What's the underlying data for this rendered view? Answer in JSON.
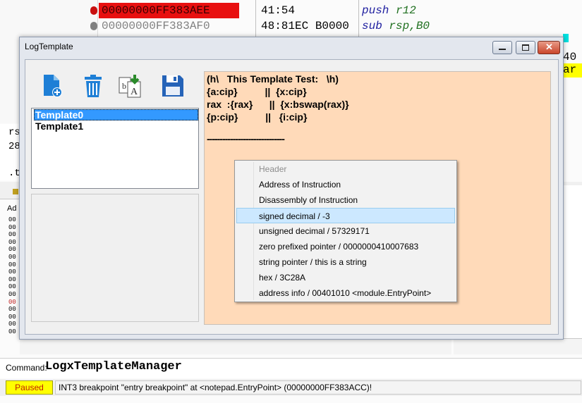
{
  "background": {
    "disasm_rows": [
      {
        "address": "00000000FF383AEE",
        "bytes": "41:54",
        "mnemonic": "push",
        "operand": "r12"
      },
      {
        "address": "00000000FF383AF0",
        "bytes": "48:81EC B0000",
        "mnemonic": "sub",
        "operand": "rsp,B0"
      }
    ],
    "register_fragments": [
      "rs",
      "28",
      ".t"
    ],
    "right_fragments": [
      "40",
      "ar"
    ],
    "hex_prefix": "Ad",
    "hex_rows": [
      "00",
      "00",
      "00",
      "00",
      "00",
      "00",
      "00",
      "00",
      "00",
      "00",
      "00",
      "00",
      "00",
      "00",
      "00",
      "00"
    ]
  },
  "dialog": {
    "title": "LogTemplate",
    "toolbar": [
      {
        "name": "new-template-icon",
        "color": "#1e7fd6"
      },
      {
        "name": "delete-template-icon",
        "color": "#1e7fd6"
      },
      {
        "name": "import-template-icon",
        "color": "#2a8a2a"
      },
      {
        "name": "save-template-icon",
        "color": "#2563b8"
      }
    ],
    "templates": [
      "Template0",
      "Template1"
    ],
    "selected_template": 0,
    "editor_lines": [
      "(h\\   This Template Test:   \\h)",
      "{a:cip}          ||  {x:cip}",
      "rax  :{rax}      ||  {x:bswap(rax)}",
      "{p:cip}          ||   {i:cip}",
      "",
      "------------------------------"
    ],
    "editor_bg": "#ffdab9"
  },
  "context_menu": {
    "items": [
      {
        "label": "Header",
        "state": "disabled"
      },
      {
        "label": "Address of Instruction",
        "state": "normal"
      },
      {
        "label": "Disassembly of Instruction",
        "state": "normal"
      },
      {
        "label": "signed decimal / -3",
        "state": "highlighted"
      },
      {
        "label": "unsigned decimal / 57329171",
        "state": "normal"
      },
      {
        "label": "zero prefixed pointer / 0000000410007683",
        "state": "normal"
      },
      {
        "label": "string pointer /  this is a string",
        "state": "normal"
      },
      {
        "label": "hex / 3C28A",
        "state": "normal"
      },
      {
        "label": "address info / 00401010 <module.EntryPoint>",
        "state": "normal"
      }
    ]
  },
  "command": {
    "label": "Command:",
    "value": "LogxTemplateManager"
  },
  "status": {
    "state": "Paused",
    "message": "INT3 breakpoint \"entry breakpoint\" at <notepad.EntryPoint> (00000000FF383ACC)!",
    "state_color": "#ffff00"
  }
}
